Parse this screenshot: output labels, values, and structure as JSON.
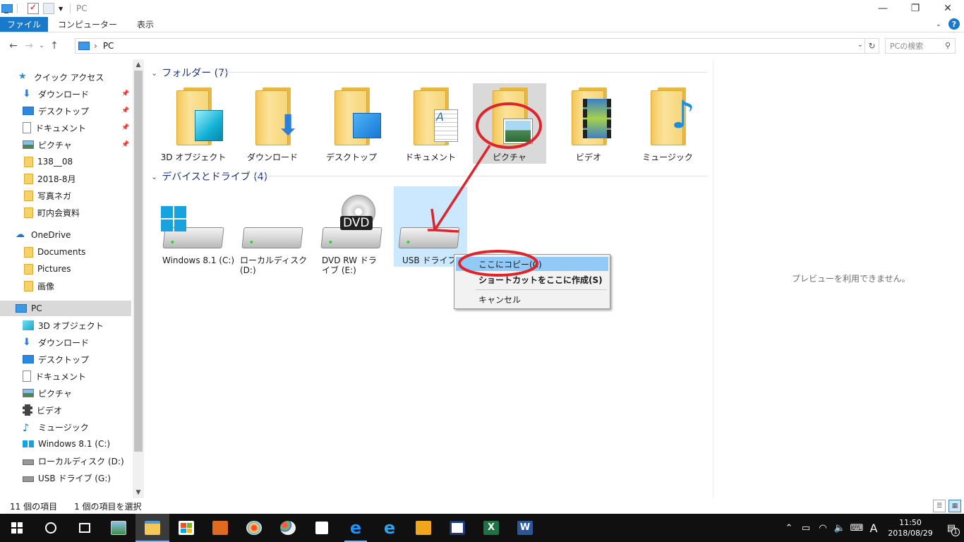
{
  "window": {
    "title": "PC"
  },
  "ribbon": {
    "tabs": [
      "ファイル",
      "コンピューター",
      "表示"
    ]
  },
  "address": {
    "location": "PC",
    "search_placeholder": "PCの検索"
  },
  "nav": {
    "items": [
      {
        "label": "クイック アクセス",
        "icon": "star-icon"
      },
      {
        "label": "ダウンロード",
        "icon": "download-icon",
        "pinned": true
      },
      {
        "label": "デスクトップ",
        "icon": "desktop-icon",
        "pinned": true
      },
      {
        "label": "ドキュメント",
        "icon": "document-icon",
        "pinned": true
      },
      {
        "label": "ピクチャ",
        "icon": "pictures-icon",
        "pinned": true
      },
      {
        "label": "138__08",
        "icon": "folder-icon"
      },
      {
        "label": "2018-8月",
        "icon": "folder-icon"
      },
      {
        "label": "写真ネガ",
        "icon": "folder-icon"
      },
      {
        "label": "町内会資料",
        "icon": "folder-icon"
      },
      {
        "label": "OneDrive",
        "icon": "cloud-icon"
      },
      {
        "label": "Documents",
        "icon": "folder-icon"
      },
      {
        "label": "Pictures",
        "icon": "folder-icon"
      },
      {
        "label": "画像",
        "icon": "folder-icon"
      },
      {
        "label": "PC",
        "icon": "pc-icon",
        "selected": true
      },
      {
        "label": "3D オブジェクト",
        "icon": "cube-icon"
      },
      {
        "label": "ダウンロード",
        "icon": "download-icon"
      },
      {
        "label": "デスクトップ",
        "icon": "desktop-icon"
      },
      {
        "label": "ドキュメント",
        "icon": "document-icon"
      },
      {
        "label": "ピクチャ",
        "icon": "pictures-icon"
      },
      {
        "label": "ビデオ",
        "icon": "video-icon"
      },
      {
        "label": "ミュージック",
        "icon": "music-icon"
      },
      {
        "label": "Windows 8.1 (C:)",
        "icon": "windows-drive-icon"
      },
      {
        "label": "ローカルディスク (D:)",
        "icon": "drive-icon"
      },
      {
        "label": "USB ドライブ (G:)",
        "icon": "usb-drive-icon"
      }
    ]
  },
  "content": {
    "folders_header": "フォルダー (7)",
    "folders": [
      {
        "label": "3D オブジェクト",
        "badge": "cube-icon"
      },
      {
        "label": "ダウンロード",
        "badge": "download-arrow-icon"
      },
      {
        "label": "デスクトップ",
        "badge": "desktop-icon"
      },
      {
        "label": "ドキュメント",
        "badge": "document-icon"
      },
      {
        "label": "ピクチャ",
        "badge": "landscape-icon",
        "highlighted": true
      },
      {
        "label": "ビデオ",
        "badge": "film-icon"
      },
      {
        "label": "ミュージック",
        "badge": "music-note-icon"
      }
    ],
    "drives_header": "デバイスとドライブ (4)",
    "drives": [
      {
        "label": "Windows 8.1 (C:)",
        "badge": "windows-logo-icon"
      },
      {
        "label": "ローカルディスク (D:)",
        "badge": "none"
      },
      {
        "label": "DVD RW ドライブ (E:)",
        "badge": "dvd-icon",
        "badge_text": "DVD"
      },
      {
        "label": "USB ドライブ (G:)",
        "badge": "none",
        "selected": true
      }
    ],
    "preview_message": "プレビューを利用できません。"
  },
  "context_menu": {
    "items": [
      "ここにコピー(C)",
      "ショートカットをここに作成(S)",
      "キャンセル"
    ]
  },
  "status": {
    "item_count": "11 個の項目",
    "selected": "1 個の項目を選択"
  },
  "taskbar": {
    "icons": [
      "start-icon",
      "cortana-icon",
      "task-view-icon",
      "photo-viewer-icon",
      "file-explorer-icon",
      "store-icon",
      "toolbox-icon",
      "paint-icon",
      "palette-icon",
      "sticky-notes-icon",
      "edge-icon",
      "ie-icon",
      "app-icon",
      "news-icon",
      "excel-icon",
      "word-icon"
    ],
    "time": "11:50",
    "date": "2018/08/29",
    "ime": "A",
    "notifications": "1"
  },
  "colors": {
    "accent": "#1979ca",
    "annotation": "#e0242b",
    "selection": "#cce8ff"
  }
}
